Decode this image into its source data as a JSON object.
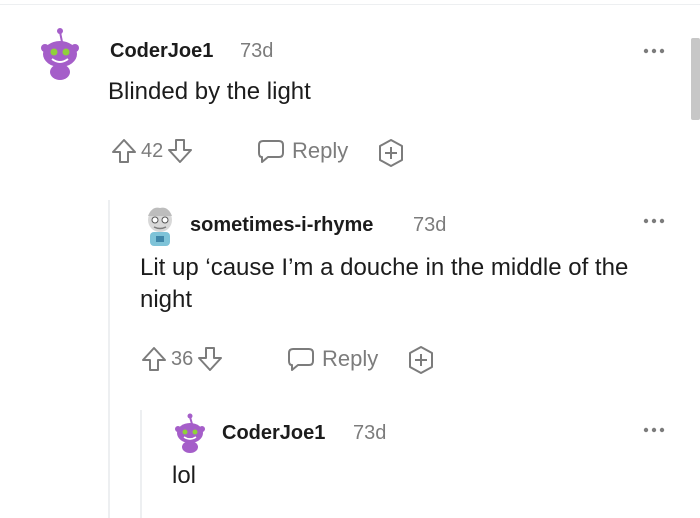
{
  "comments": [
    {
      "username": "CoderJoe1",
      "age": "73d",
      "body": "Blinded by the light",
      "votes": "42",
      "reply_label": "Reply"
    },
    {
      "username": "sometimes-i-rhyme",
      "age": "73d",
      "body": "Lit up ‘cause I’m a douche in the middle of the night",
      "votes": "36",
      "reply_label": "Reply"
    },
    {
      "username": "CoderJoe1",
      "age": "73d",
      "body": "lol"
    }
  ],
  "icons": {
    "upvote": "upvote-arrow-icon",
    "downvote": "downvote-arrow-icon",
    "reply": "speech-bubble-icon",
    "award": "add-award-icon",
    "more": "more-options-icon",
    "avatar": "snoo-avatar-icon"
  },
  "colors": {
    "avatar_purple": "#a55ec9",
    "muted_gray": "#7c7c7c",
    "text": "#1c1c1c"
  }
}
